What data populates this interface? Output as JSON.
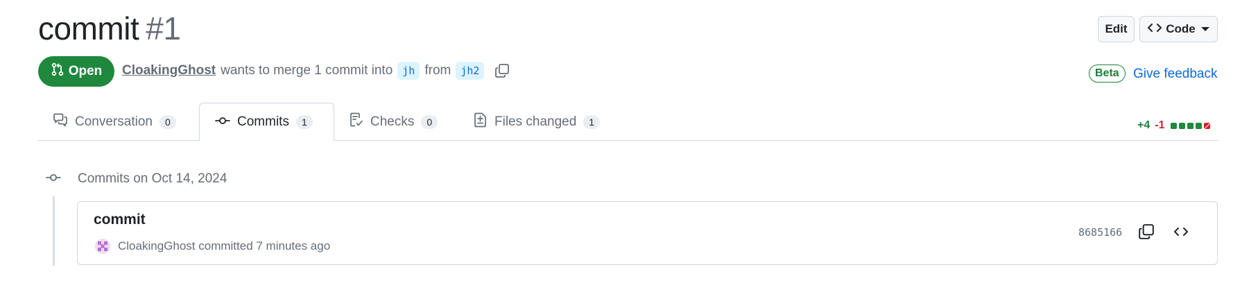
{
  "pr": {
    "title": "commit",
    "number": "#1",
    "state": "Open",
    "author": "CloakingGhost",
    "merge_text": "wants to merge 1 commit into",
    "base_branch": "jh",
    "from_text": "from",
    "head_branch": "jh2"
  },
  "actions": {
    "edit_label": "Edit",
    "code_label": "Code"
  },
  "feedback": {
    "beta_label": "Beta",
    "link_label": "Give feedback"
  },
  "tabs": [
    {
      "label": "Conversation",
      "count": "0",
      "icon": "comment-discussion-icon"
    },
    {
      "label": "Commits",
      "count": "1",
      "icon": "git-commit-icon",
      "selected": true
    },
    {
      "label": "Checks",
      "count": "0",
      "icon": "checklist-icon"
    },
    {
      "label": "Files changed",
      "count": "1",
      "icon": "file-diff-icon"
    }
  ],
  "diffstat": {
    "additions": "+4",
    "deletions": "-1"
  },
  "commits": {
    "group_title": "Commits on Oct 14, 2024",
    "items": [
      {
        "title": "commit",
        "author": "CloakingGhost",
        "meta": "committed 7 minutes ago",
        "sha": "8685166"
      }
    ]
  },
  "colors": {
    "open_green": "#1f883d",
    "link_blue": "#0969da",
    "branch_bg": "#ddf4ff",
    "deletion_red": "#cf222e"
  }
}
